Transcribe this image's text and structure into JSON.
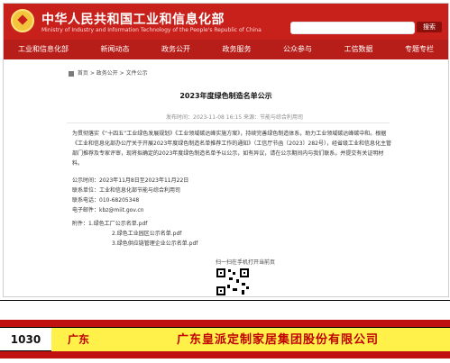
{
  "header": {
    "title": "中华人民共和国工业和信息化部",
    "subtitle": "Ministry of Industry and Information Technology of the People's Republic of China",
    "search_button": "搜索"
  },
  "nav": {
    "items": [
      "工业和信息化部",
      "新闻动态",
      "政务公开",
      "政务服务",
      "公众参与",
      "工信数据",
      "专题专栏"
    ]
  },
  "breadcrumb": "首页 > 政务公开 > 文件公示",
  "article": {
    "title": "2023年度绿色制造名单公示",
    "meta": "发布时间：2023-11-08 16:15    来源：节能与综合利用司",
    "paragraph": "为贯彻落实《“十四五”工业绿色发展规划》《工业领域碳达峰实施方案》，持续完善绿色制造体系，助力工业领域碳达峰碳中和。根据《工业和信息化部办公厅关于开展2023年度绿色制造名单推荐工作的通知》（工信厅节函〔2023〕282号），经省级工业和信息化主管部门推荐及专家评审，现将拟确定的2023年度绿色制造名单予以公示，如有异议，请在公示期间内与我们联系，并提交有关证明材料。",
    "info_lines": [
      "公示时间：2023年11月8日至2023年11月22日",
      "联系单位：工业和信息化部节能与综合利用司",
      "联系电话：010-68205348",
      "电子邮件：kbz@miit.gov.cn"
    ],
    "attachments_label": "附件：1.绿色工厂公示名单.pdf",
    "attachments_sub": [
      "2.绿色工业园区公示名单.pdf",
      "3.绿色供应链管理企业公示名单.pdf"
    ],
    "qr_caption": "扫一扫在手机打开当前页"
  },
  "highlight_row": {
    "number": "1030",
    "province": "广东",
    "company": "广东皇派定制家居集团股份有限公司"
  },
  "colors": {
    "header_red": "#c8201b",
    "highlight_yellow": "#fff14a",
    "text_red": "#c00000"
  }
}
